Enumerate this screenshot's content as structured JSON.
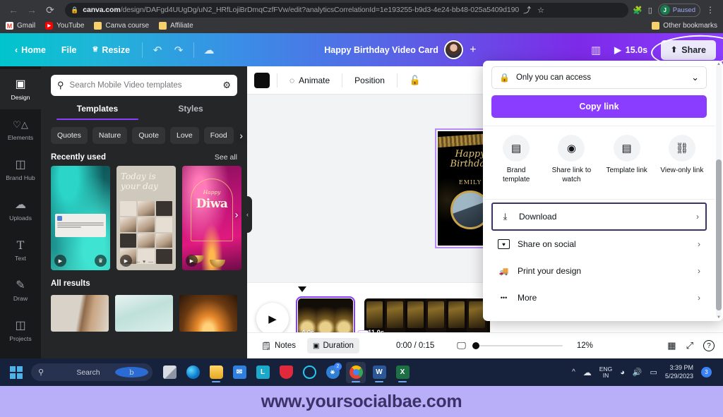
{
  "browser": {
    "url_domain": "canva.com",
    "url_path": "/design/DAFgd4UUgDg/uN2_HRfLojiBrDmqCzfFVw/edit?analyticsCorrelationId=1e193255-b9d3-4e24-bb48-025a5409d190",
    "back_icon": "←",
    "forward_icon": "→",
    "reload_icon": "⟳",
    "lock_icon": "🔒",
    "share_icon": "⤴",
    "star_icon": "☆",
    "extensions_icon": "🧩",
    "sidepanel_icon": "▯",
    "menu_icon": "⋮",
    "profile_initial": "J",
    "profile_status": "Paused",
    "bookmarks": [
      {
        "label": "Gmail",
        "icon": "gmail-icon"
      },
      {
        "label": "YouTube",
        "icon": "youtube-icon"
      },
      {
        "label": "Canva course",
        "icon": "folder-icon"
      },
      {
        "label": "Affiliate",
        "icon": "folder-icon"
      }
    ],
    "other_bookmarks": "Other bookmarks"
  },
  "canva_top": {
    "home": "Home",
    "file": "File",
    "resize": "Resize",
    "undo_icon": "↶",
    "redo_icon": "↷",
    "cloud_icon": "☁",
    "doc_title": "Happy Birthday Video Card",
    "add_collaborator": "+",
    "analytics_icon": "▥",
    "play_icon": "▶",
    "duration": "15.0s",
    "share_label": "Share",
    "share_icon": "⬆"
  },
  "rail": {
    "items": [
      {
        "label": "Design",
        "icon": "design-icon",
        "active": true
      },
      {
        "label": "Elements",
        "icon": "elements-icon",
        "active": false
      },
      {
        "label": "Brand Hub",
        "icon": "brand-hub-icon",
        "active": false
      },
      {
        "label": "Uploads",
        "icon": "uploads-icon",
        "active": false
      },
      {
        "label": "Text",
        "icon": "text-icon",
        "active": false
      },
      {
        "label": "Draw",
        "icon": "draw-icon",
        "active": false
      },
      {
        "label": "Projects",
        "icon": "projects-icon",
        "active": false
      }
    ]
  },
  "panel": {
    "search_placeholder": "Search Mobile Video templates",
    "search_value": "",
    "filter_icon": "⚙",
    "tabs": [
      {
        "label": "Templates",
        "active": true
      },
      {
        "label": "Styles",
        "active": false
      }
    ],
    "chips": [
      "Quotes",
      "Nature",
      "Quote",
      "Love",
      "Food"
    ],
    "chips_next_icon": "›",
    "recently_used": "Recently used",
    "see_all": "See all",
    "all_results": "All results",
    "template2_text": "Today is your day",
    "template3_greeting": "Happy",
    "template3_title": "Diwa",
    "play_icon": "▶",
    "crown_icon": "♛",
    "next_icon": "›",
    "collapse_icon": "‹"
  },
  "editor": {
    "toolbar": {
      "color_swatch": "#0d0d0d",
      "animate": "Animate",
      "animate_icon": "◌",
      "position": "Position",
      "lock_icon": "🔓"
    },
    "design": {
      "greeting_line1": "Happy",
      "greeting_line2": "Birthday",
      "name": "EMILY"
    },
    "timeline": {
      "play_icon": "▶",
      "clip1_duration": "4.0s",
      "clip2_duration": "11.0s",
      "add_transition_icon": "◇"
    },
    "statusbar": {
      "notes": "Notes",
      "notes_icon": "🗒",
      "duration": "Duration",
      "duration_icon": "▣",
      "time": "0:00 / 0:15",
      "screen_icon": "🖵",
      "zoom": "12%",
      "grid_icon": "▦",
      "expand_icon": "⤢",
      "help_icon": "?"
    }
  },
  "share_popup": {
    "access_label": "Only you can access",
    "access_lock_icon": "🔒",
    "access_chevron": "⌄",
    "copy_link": "Copy link",
    "quick_actions": [
      {
        "label": "Brand template",
        "icon": "brand-template-icon",
        "glyph": "▤"
      },
      {
        "label": "Share link to watch",
        "icon": "eye-icon",
        "glyph": "◉"
      },
      {
        "label": "Template link",
        "icon": "template-link-icon",
        "glyph": "▤"
      },
      {
        "label": "View-only link",
        "icon": "chain-link-icon",
        "glyph": "⛓"
      }
    ],
    "menu_items": [
      {
        "label": "Download",
        "icon": "download-icon",
        "glyph": "⤓",
        "chevron": "›",
        "highlighted": true
      },
      {
        "label": "Share on social",
        "icon": "social-heart-icon",
        "glyph": "♥",
        "chevron": "›",
        "highlighted": false
      },
      {
        "label": "Print your design",
        "icon": "delivery-truck-icon",
        "glyph": "🚚",
        "chevron": "›",
        "highlighted": false
      },
      {
        "label": "More",
        "icon": "ellipsis-icon",
        "glyph": "•••",
        "chevron": "›",
        "highlighted": false
      }
    ]
  },
  "taskbar": {
    "search_placeholder": "Search",
    "bing_icon": "b",
    "apps": [
      {
        "name": "task-view",
        "class": "ic-task",
        "glyph": "",
        "badge": "",
        "active": false,
        "open": false
      },
      {
        "name": "microsoft-edge",
        "class": "ic-edge",
        "glyph": "",
        "badge": "",
        "active": false,
        "open": false
      },
      {
        "name": "file-explorer",
        "class": "ic-folder",
        "glyph": "",
        "badge": "",
        "active": false,
        "open": true
      },
      {
        "name": "mail",
        "class": "ic-mail",
        "glyph": "✉",
        "badge": "",
        "active": false,
        "open": false
      },
      {
        "name": "app-l",
        "class": "ic-l",
        "glyph": "L",
        "badge": "",
        "active": false,
        "open": false
      },
      {
        "name": "antivirus-shield",
        "class": "ic-shield",
        "glyph": "",
        "badge": "",
        "active": false,
        "open": false
      },
      {
        "name": "opera-browser",
        "class": "ic-opera",
        "glyph": "",
        "badge": "",
        "active": false,
        "open": false
      },
      {
        "name": "password-key",
        "class": "ic-key",
        "glyph": "⚷",
        "badge": "2",
        "active": false,
        "open": false
      },
      {
        "name": "google-chrome",
        "class": "ic-chrome",
        "glyph": "",
        "badge": "",
        "active": true,
        "open": true
      },
      {
        "name": "microsoft-word",
        "class": "ic-word",
        "glyph": "W",
        "badge": "",
        "active": false,
        "open": true
      },
      {
        "name": "microsoft-excel",
        "class": "ic-excel",
        "glyph": "X",
        "badge": "",
        "active": false,
        "open": true
      }
    ],
    "chevron_up": "^",
    "cloud_icon": "☁",
    "lang_line1": "ENG",
    "lang_line2": "IN",
    "wifi_icon": "◗",
    "volume_icon": "🔊",
    "battery_icon": "▰",
    "time": "3:39 PM",
    "date": "5/29/2023",
    "notification_count": "3"
  },
  "watermark": {
    "text": "www.yoursocialbae.com"
  }
}
